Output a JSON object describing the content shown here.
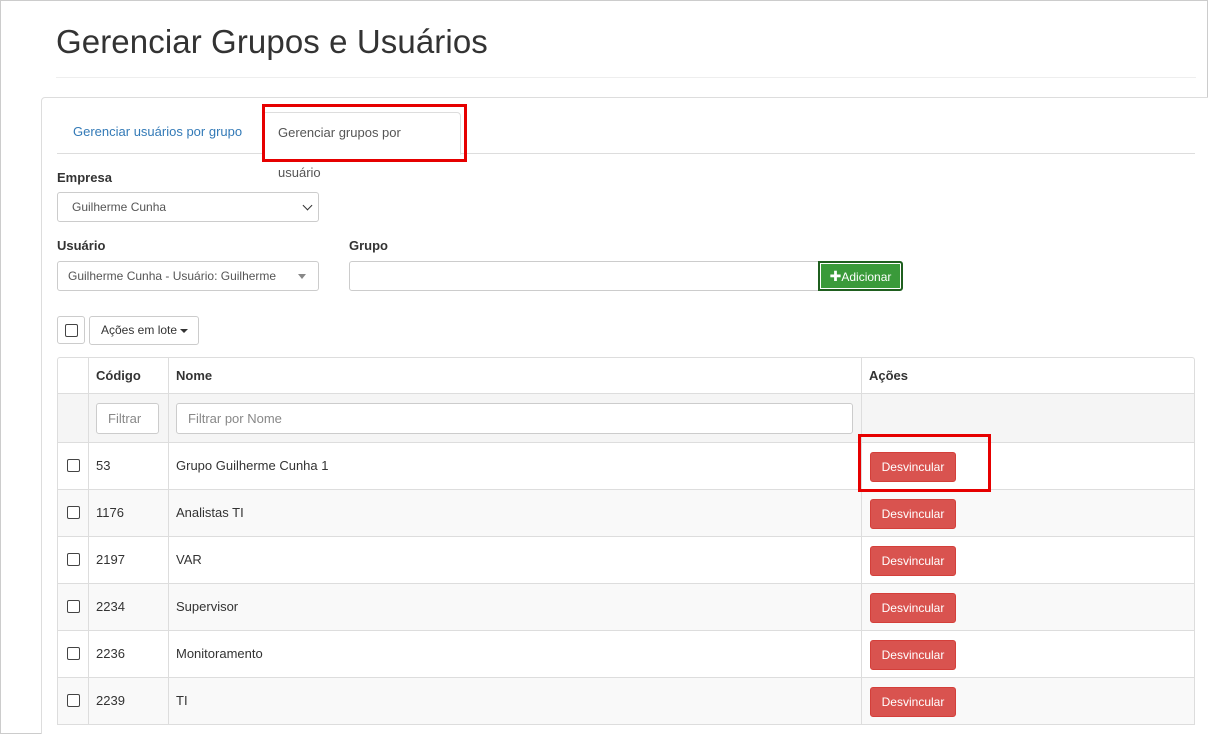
{
  "page": {
    "title": "Gerenciar Grupos e Usuários"
  },
  "tabs": [
    {
      "label": "Gerenciar usuários por grupo",
      "active": false
    },
    {
      "label": "Gerenciar grupos por usuário",
      "active": true
    }
  ],
  "form": {
    "empresa_label": "Empresa",
    "empresa_value": "Guilherme Cunha",
    "usuario_label": "Usuário",
    "usuario_value": "Guilherme Cunha - Usuário: Guilherme",
    "grupo_label": "Grupo",
    "grupo_value": "",
    "add_label": "Adicionar",
    "add_icon": "plus-icon"
  },
  "bulk": {
    "label": "Ações em lote"
  },
  "table": {
    "headers": {
      "codigo": "Código",
      "nome": "Nome",
      "acoes": "Ações"
    },
    "filters": {
      "codigo_placeholder": "Filtrar",
      "nome_placeholder": "Filtrar por Nome"
    },
    "action_label": "Desvincular",
    "rows": [
      {
        "codigo": "53",
        "nome": "Grupo Guilherme Cunha 1"
      },
      {
        "codigo": "1176",
        "nome": "Analistas TI"
      },
      {
        "codigo": "2197",
        "nome": "VAR"
      },
      {
        "codigo": "2234",
        "nome": "Supervisor"
      },
      {
        "codigo": "2236",
        "nome": "Monitoramento"
      },
      {
        "codigo": "2239",
        "nome": "TI"
      }
    ]
  },
  "colors": {
    "accent": "#337ab7",
    "danger": "#d9534f",
    "success": "#3a9a3a",
    "highlight": "#e60000"
  }
}
